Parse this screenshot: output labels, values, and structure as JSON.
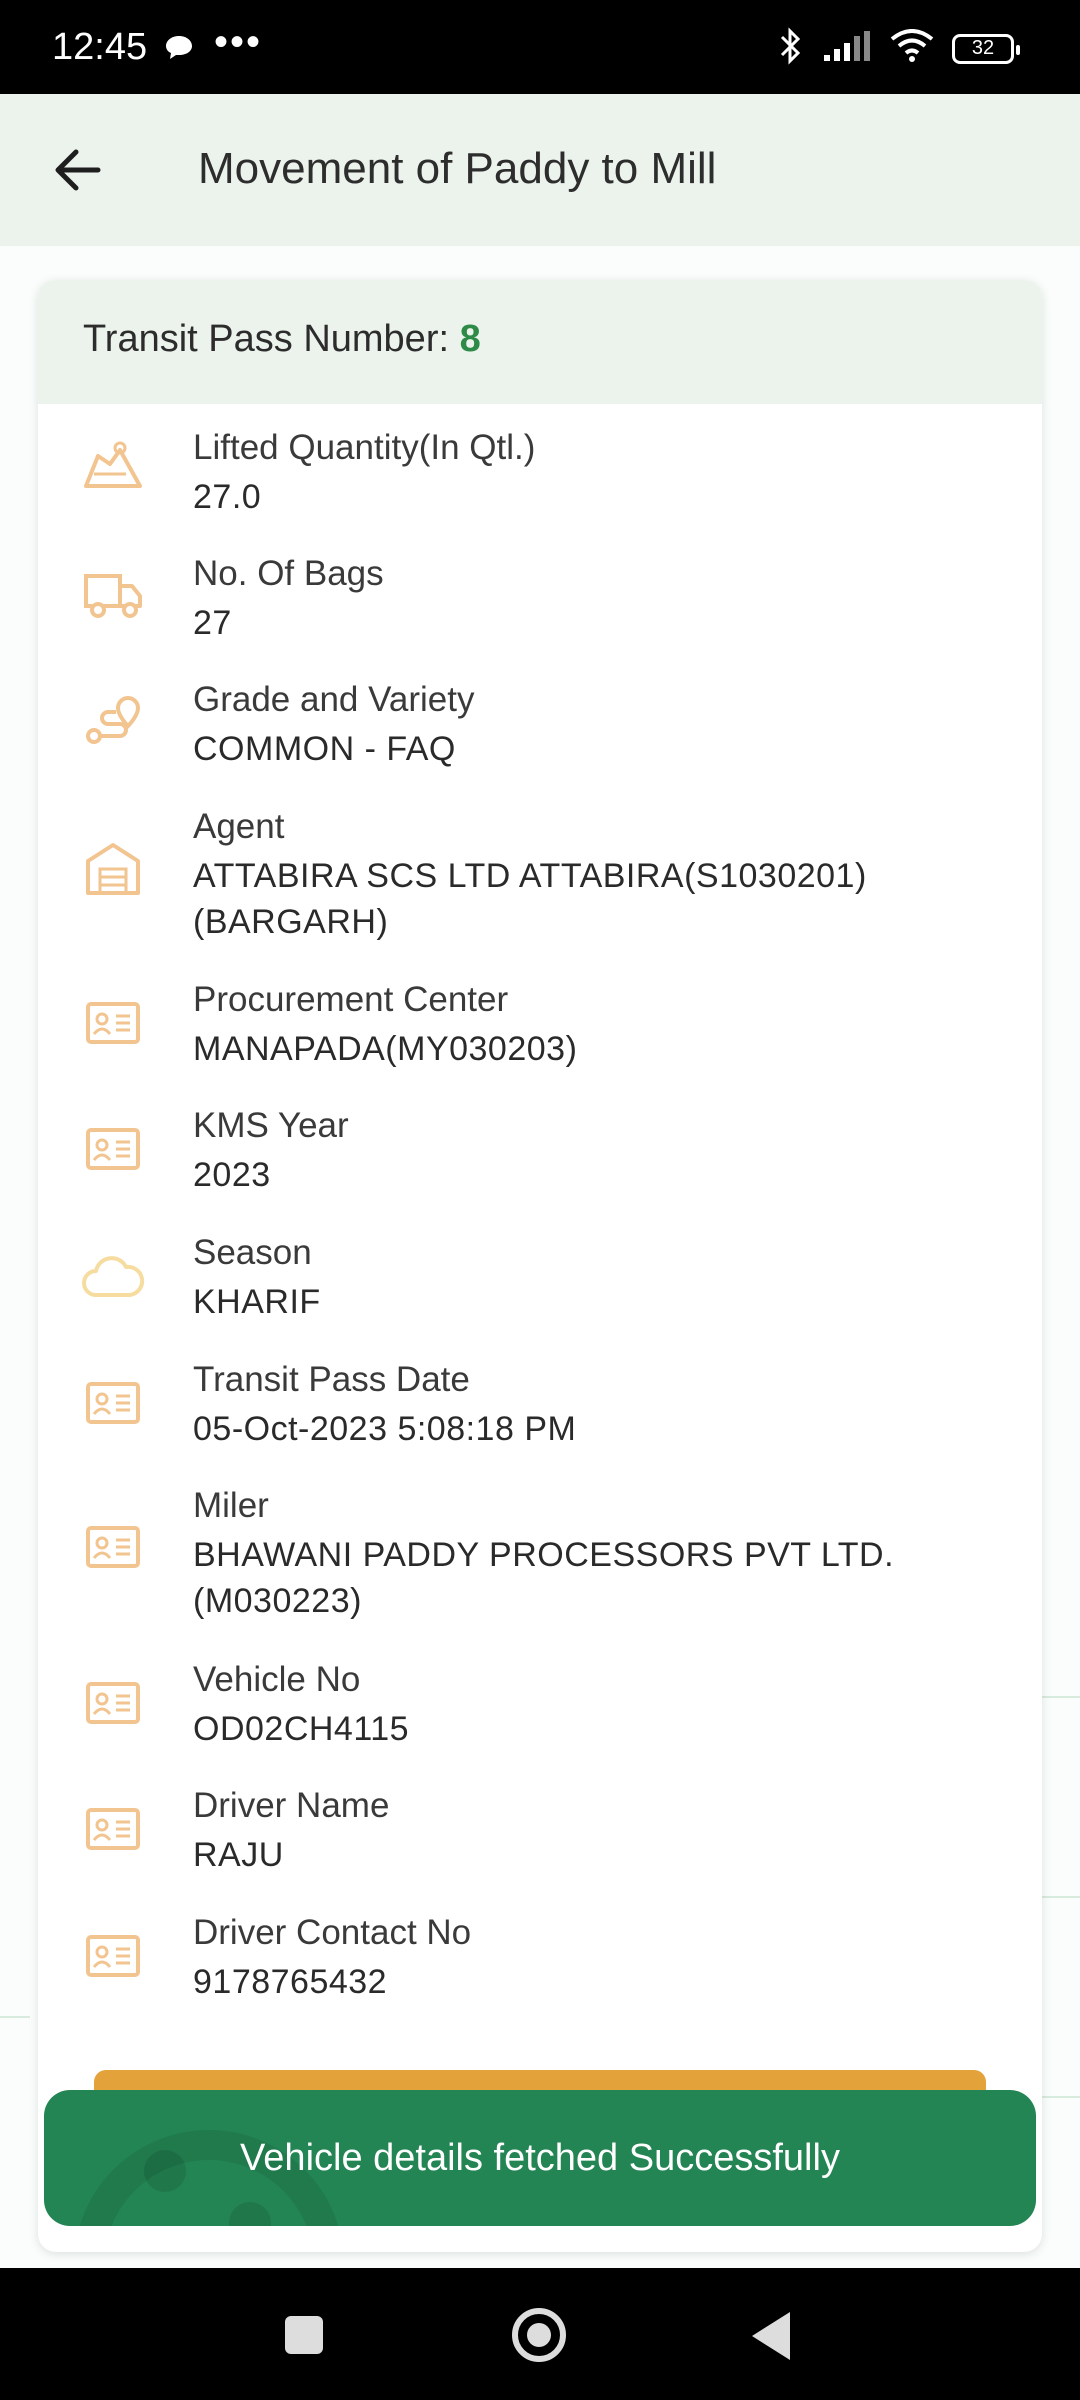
{
  "status_bar": {
    "time": "12:45",
    "more": "•••",
    "battery": "32"
  },
  "appbar": {
    "title": "Movement of Paddy to Mill"
  },
  "card": {
    "header_label": "Transit Pass Number:",
    "header_value": "8",
    "rows": [
      {
        "icon": "weighing-scale-icon",
        "label": "Lifted Quantity(In Qtl.)",
        "value": "27.0"
      },
      {
        "icon": "truck-icon",
        "label": "No. Of Bags",
        "value": "27"
      },
      {
        "icon": "route-pin-icon",
        "label": "Grade and Variety",
        "value": "COMMON - FAQ"
      },
      {
        "icon": "warehouse-icon",
        "label": "Agent",
        "value": "ATTABIRA SCS LTD ATTABIRA(S1030201)(BARGARH)"
      },
      {
        "icon": "id-card-icon",
        "label": "Procurement Center",
        "value": "MANAPADA(MY030203)"
      },
      {
        "icon": "id-card-icon",
        "label": "KMS Year",
        "value": "2023"
      },
      {
        "icon": "cloud-icon",
        "label": "Season",
        "value": "KHARIF"
      },
      {
        "icon": "id-card-icon",
        "label": "Transit Pass Date",
        "value": "05-Oct-2023 5:08:18 PM"
      },
      {
        "icon": "id-card-icon",
        "label": "Miler",
        "value": "BHAWANI PADDY PROCESSORS PVT LTD.(M030223)"
      },
      {
        "icon": "id-card-icon",
        "label": "Vehicle No",
        "value": "OD02CH4115"
      },
      {
        "icon": "id-card-icon",
        "label": "Driver Name",
        "value": "RAJU"
      },
      {
        "icon": "id-card-icon",
        "label": "Driver Contact No",
        "value": "9178765432"
      }
    ]
  },
  "toast": {
    "message": "Vehicle details fetched Successfully"
  },
  "colors": {
    "accent": "#2e8b47",
    "icon": "#f2c48f",
    "toast": "#238553",
    "button": "#e3a23a"
  }
}
